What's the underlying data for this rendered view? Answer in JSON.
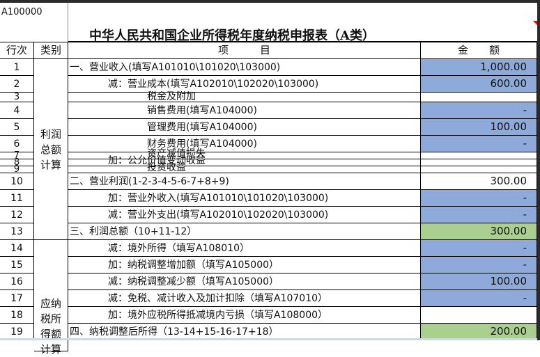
{
  "sheet_code": "A100000",
  "title": "中华人民共和国企业所得税年度纳税申报表（A类）",
  "headers": {
    "row_no": "行次",
    "category": "类别",
    "item": "项　　　目",
    "amount": "金　　额"
  },
  "categories": [
    "利润总额计算",
    "应纳税所得额计算"
  ],
  "rows": [
    {
      "no": "1",
      "item": "一、营业收入(填写A101010\\101020\\103000)",
      "amount": "1,000.00",
      "fill": "blue"
    },
    {
      "no": "2",
      "item": "减：营业成本(填写A102010\\102020\\103000)",
      "amount": "600.00",
      "fill": "blue"
    },
    {
      "no": "3",
      "item": "税金及附加",
      "amount": "",
      "fill": ""
    },
    {
      "no": "4",
      "item": "销售费用(填写A104000)",
      "amount": "-",
      "fill": "blue"
    },
    {
      "no": "5",
      "item": "管理费用(填写A104000)",
      "amount": "100.00",
      "fill": "blue"
    },
    {
      "no": "6",
      "item": "财务费用(填写A104000)",
      "amount": "-",
      "fill": "blue"
    },
    {
      "no": "7",
      "item": "资产减值损失",
      "amount": "",
      "fill": ""
    },
    {
      "no": "8",
      "item": "加：公允价值变动收益",
      "amount": "",
      "fill": ""
    },
    {
      "no": "9",
      "item": "投资收益",
      "amount": "",
      "fill": ""
    },
    {
      "no": "10",
      "item": "二、营业利润(1-2-3-4-5-6-7+8+9)",
      "amount": "300.00",
      "fill": ""
    },
    {
      "no": "11",
      "item": "加：营业外收入(填写A101010\\101020\\103000)",
      "amount": "-",
      "fill": "blue"
    },
    {
      "no": "12",
      "item": "减：营业外支出(填写A102010\\102020\\103000)",
      "amount": "-",
      "fill": "blue"
    },
    {
      "no": "13",
      "item": "三、利润总额（10+11-12）",
      "amount": "300.00",
      "fill": "green"
    },
    {
      "no": "14",
      "item": "减：境外所得（填写A108010）",
      "amount": "-",
      "fill": "blue"
    },
    {
      "no": "15",
      "item": "加：纳税调整增加额（填写A105000）",
      "amount": "-",
      "fill": "blue"
    },
    {
      "no": "16",
      "item": "减：纳税调整减少额（填写A105000）",
      "amount": "100.00",
      "fill": "blue"
    },
    {
      "no": "17",
      "item": "减：免税、减计收入及加计扣除（填写A107010）",
      "amount": "-",
      "fill": "blue"
    },
    {
      "no": "18",
      "item": "加：境外应税所得抵减境内亏损（填写A108000）",
      "amount": "",
      "fill": ""
    },
    {
      "no": "19",
      "item": "四、纳税调整后所得（13-14+15-16-17+18）",
      "amount": "200.00",
      "fill": "green"
    }
  ],
  "colors": {
    "blue": "#8eaadb",
    "green": "#a9d08e"
  }
}
